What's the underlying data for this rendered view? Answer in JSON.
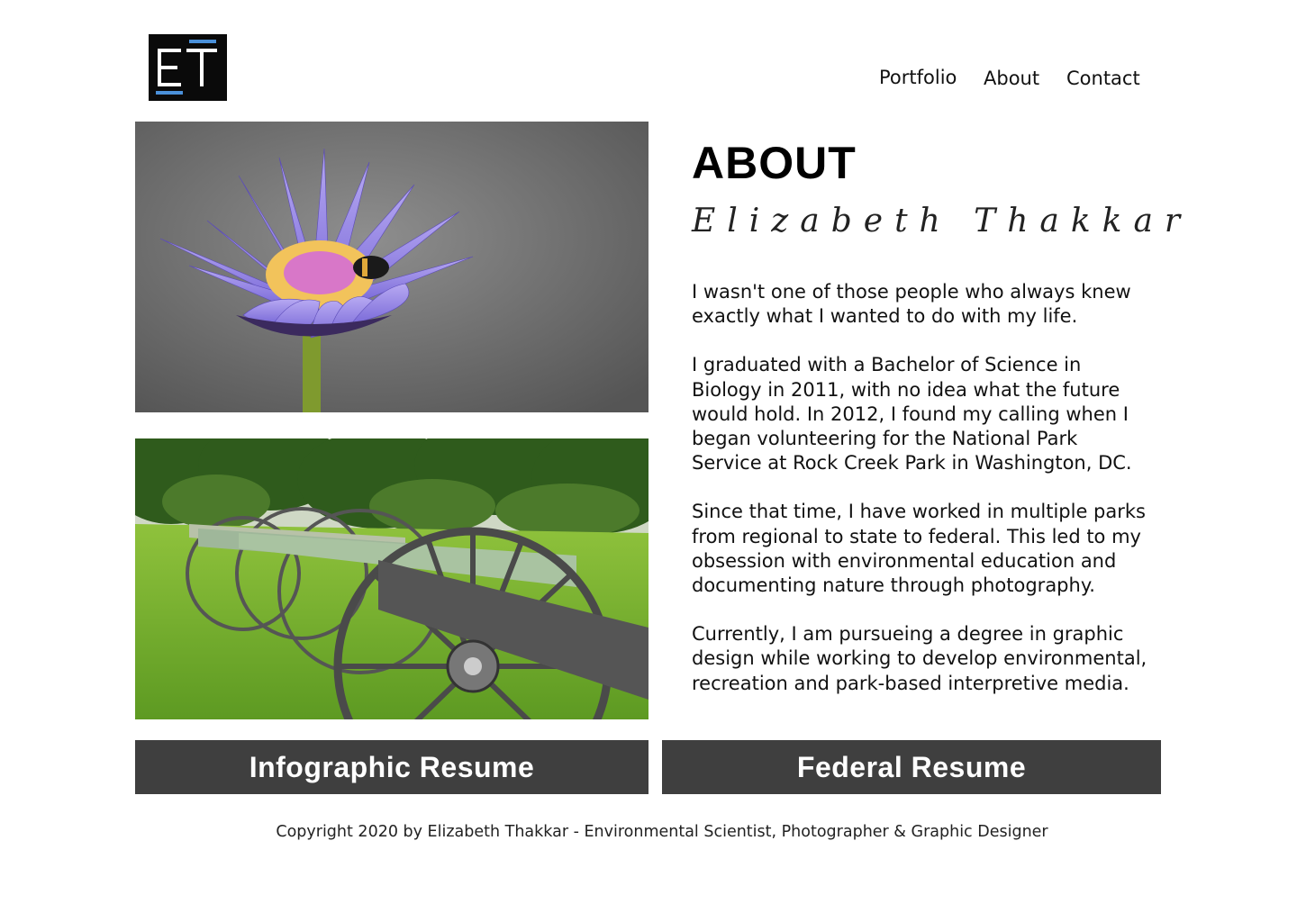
{
  "logo": {
    "letters": "ET"
  },
  "nav": {
    "items": [
      "Portfolio",
      "About",
      "Contact"
    ]
  },
  "images": {
    "top": "flower-photo",
    "bottom": "cannons-photo"
  },
  "about": {
    "heading": "ABOUT",
    "signature": "Elizabeth Thakkar",
    "paragraphs": [
      "I wasn't one of those people who always knew exactly what I wanted to do with my life.",
      "I graduated with a Bachelor of Science in Biology in 2011, with no idea what the future would hold. In 2012, I found my calling when I began volunteering for the National Park Service at Rock Creek Park in Washington, DC.",
      "Since that time, I have worked in multiple parks from regional to state to federal. This led to my obsession with environmental education and documenting nature through photography.",
      "Currently, I am pursueing a degree in graphic design while working to develop environmental, recreation and park-based interpretive media."
    ]
  },
  "buttons": {
    "infographic": "Infographic Resume",
    "federal": "Federal Resume"
  },
  "footer": {
    "copyright": "Copyright 2020 by Elizabeth Thakkar - Environmental Scientist, Photographer & Graphic Designer"
  },
  "colors": {
    "button_bg": "#3f3f3f",
    "logo_bg": "#0a0a0a",
    "logo_accent": "#4a90d9"
  }
}
